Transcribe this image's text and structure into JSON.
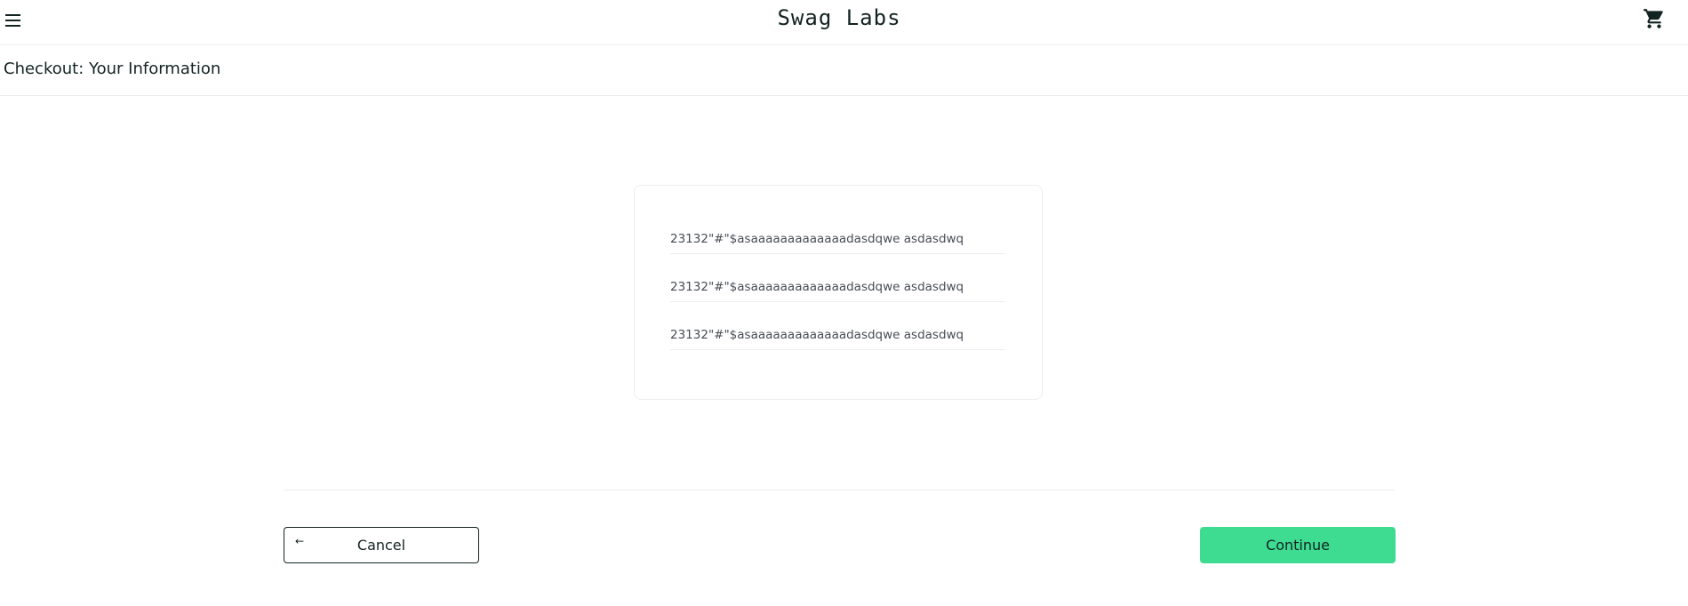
{
  "header": {
    "app_logo": "Swag Labs",
    "menu_icon": "menu-icon",
    "cart_icon": "cart-icon"
  },
  "secondary_header": {
    "title": "Checkout: Your Information"
  },
  "form": {
    "first_name": {
      "value": "23132\"#\"$asaaaaaaaaaaaaadasdqwe asdasdwq"
    },
    "last_name": {
      "value": "23132\"#\"$asaaaaaaaaaaaaadasdqwe asdasdwq"
    },
    "postal_code": {
      "value": "23132\"#\"$asaaaaaaaaaaaaadasdqwe asdasdwq"
    }
  },
  "actions": {
    "cancel_label": "Cancel",
    "cancel_icon": "arrow-left-icon",
    "continue_label": "Continue"
  },
  "colors": {
    "accent": "#3ddc91",
    "text": "#132322",
    "border": "#ededed"
  }
}
